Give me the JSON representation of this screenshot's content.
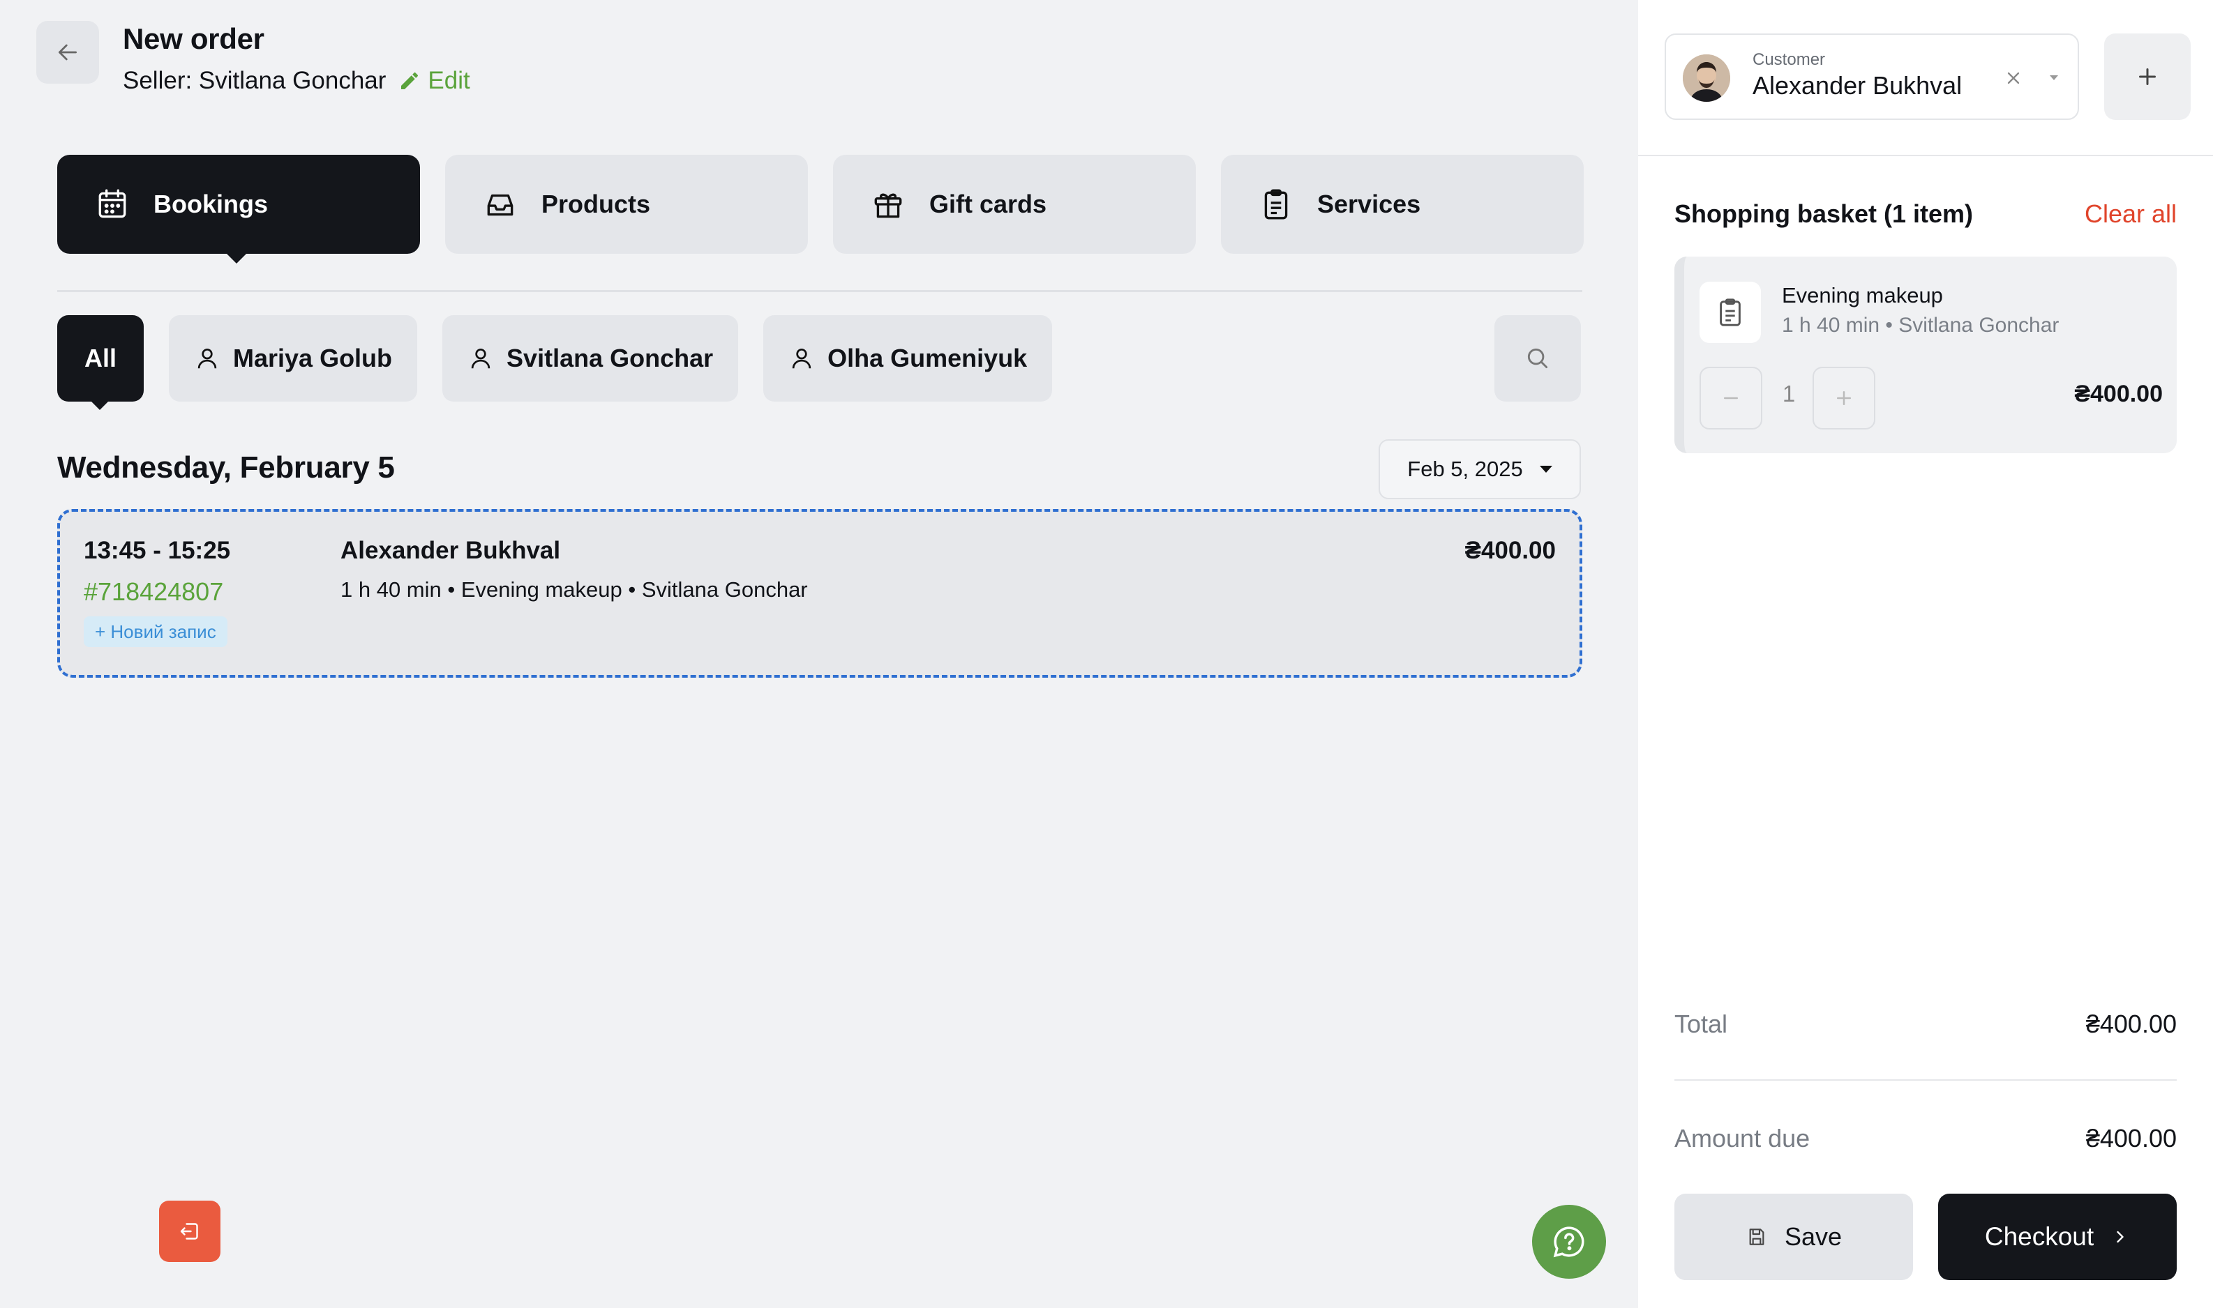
{
  "header": {
    "title": "New order",
    "seller_label": "Seller: Svitlana Gonchar",
    "edit_label": "Edit"
  },
  "tabs": [
    {
      "label": "Bookings",
      "icon": "calendar-icon",
      "active": true
    },
    {
      "label": "Products",
      "icon": "inbox-icon",
      "active": false
    },
    {
      "label": "Gift cards",
      "icon": "gift-icon",
      "active": false
    },
    {
      "label": "Services",
      "icon": "clipboard-icon",
      "active": false
    }
  ],
  "filters": [
    {
      "label": "All",
      "active": true
    },
    {
      "label": "Mariya Golub",
      "icon": "user-icon"
    },
    {
      "label": "Svitlana Gonchar",
      "icon": "user-icon"
    },
    {
      "label": "Olha Gumeniyuk",
      "icon": "user-icon"
    }
  ],
  "day": {
    "title": "Wednesday, February 5",
    "date_picker": "Feb 5, 2025"
  },
  "booking": {
    "time": "13:45 - 15:25",
    "id": "#718424807",
    "badge": "+ Новий запис",
    "customer": "Alexander Bukhval",
    "details": "1 h 40 min • Evening makeup • Svitlana Gonchar",
    "price": "₴400.00"
  },
  "customer": {
    "label": "Customer",
    "name": "Alexander Bukhval"
  },
  "basket": {
    "title": "Shopping basket (1 item)",
    "clear_all": "Clear all",
    "items": [
      {
        "name": "Evening makeup",
        "details": "1 h 40 min • Svitlana Gonchar",
        "quantity": "1",
        "price": "₴400.00"
      }
    ]
  },
  "totals": {
    "total_label": "Total",
    "total_value": "₴400.00",
    "due_label": "Amount due",
    "due_value": "₴400.00"
  },
  "actions": {
    "save": "Save",
    "checkout": "Checkout"
  },
  "colors": {
    "accent_green": "#5aa33b",
    "dark": "#14161b",
    "danger": "#e0442b",
    "booking_border": "#2f6fd1"
  }
}
